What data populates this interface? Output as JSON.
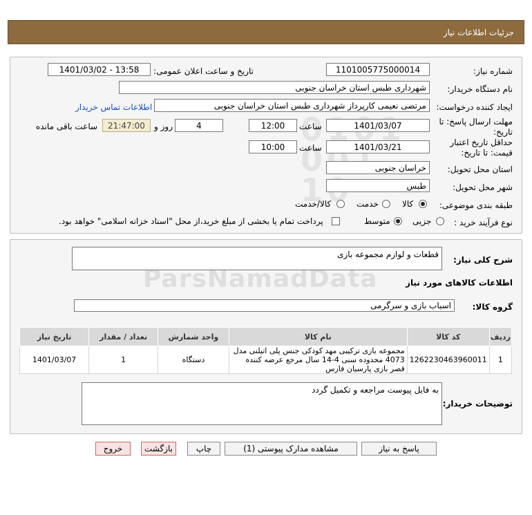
{
  "header": {
    "title": "جزئیات اطلاعات نیاز"
  },
  "form": {
    "need_number_label": "شماره نیاز:",
    "need_number": "1101005775000014",
    "announce_label": "تاریخ و ساعت اعلان عمومی:",
    "announce_value": "1401/03/02 - 13:58",
    "buyer_org_label": "نام دستگاه خریدار:",
    "buyer_org": "شهرداری طبس استان خراسان جنوبی",
    "creator_label": "ایجاد کننده درخواست:",
    "creator": "مرتضی نعیمی کارپرداز شهرداری طبس استان خراسان جنوبی",
    "contact_link": "اطلاعات تماس خریدار",
    "deadline_label_1": "مهلت ارسال پاسخ: تا",
    "deadline_label_2": "تاریخ:",
    "deadline_date": "1401/03/07",
    "time_label": "ساعت",
    "deadline_time": "12:00",
    "days_value": "4",
    "days_label": "روز و",
    "remaining_time": "21:47:00",
    "remaining_label": "ساعت باقی مانده",
    "validity_label_1": "حداقل تاریخ اعتبار",
    "validity_label_2": "قیمت: تا تاریخ:",
    "validity_date": "1401/03/21",
    "validity_time": "10:00",
    "province_label": "استان محل تحویل:",
    "province": "خراسان جنوبی",
    "city_label": "شهر محل تحویل:",
    "city": "طبس",
    "category_label": "طبقه بندی موضوعی:",
    "category_options": [
      "کالا",
      "خدمت",
      "کالا/خدمت"
    ],
    "category_selected": "کالا",
    "process_label": "نوع فرآیند خرید :",
    "process_options": [
      "جزیی",
      "متوسط"
    ],
    "process_selected": "متوسط",
    "payment_note": "پرداخت تمام یا بخشی از مبلغ خرید،از محل \"اسناد خزانه اسلامی\" خواهد بود."
  },
  "details": {
    "summary_label": "شرح کلی نیاز:",
    "summary": "قطعات و لوازم مجموعه بازی",
    "goods_info_title": "اطلاعات کالاهای مورد نیاز",
    "goods_group_label": "گروه کالا:",
    "goods_group": "اسباب بازی و سرگرمی",
    "table": {
      "headers": [
        "ردیف",
        "کد کالا",
        "نام کالا",
        "واحد شمارش",
        "تعداد / مقدار",
        "تاریخ نیاز"
      ],
      "rows": [
        {
          "row": "1",
          "code": "1262230463960011",
          "name": "مجموعه بازی ترکیبی مهد کودکی جنس پلی اتیلنی مدل 4073 محدوده سنی 4-14 سال مرجع عرضه کننده قصر بازی پارسیان فارس",
          "unit": "دستگاه",
          "qty": "1",
          "date": "1401/03/07"
        }
      ]
    },
    "buyer_notes_label": "توضیحات خریدار:",
    "buyer_notes": "به فایل پیوست مراجعه و تکمیل گردد"
  },
  "buttons": {
    "reply": "پاسخ به نیاز",
    "view_docs": "مشاهده مدارک پیوستی (1)",
    "print": "چاپ",
    "back": "بازگشت",
    "exit": "خروج"
  }
}
